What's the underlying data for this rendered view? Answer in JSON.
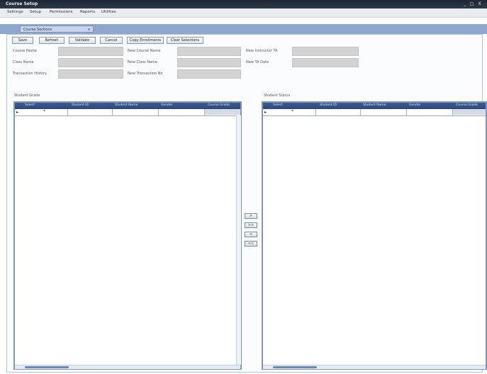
{
  "window": {
    "app_title": "Course Setup",
    "controls": [
      "_",
      "□",
      "X"
    ]
  },
  "menu": [
    "Settings",
    "Setup",
    "Permissions",
    "Reports",
    "Utilities"
  ],
  "document_tab": {
    "label": "Course Sections",
    "close_label": "x"
  },
  "toolbar": [
    "Save",
    "Refresh",
    "Validate",
    "Cancel",
    "Copy Enrollments",
    "Clear Selections"
  ],
  "form": {
    "course_name": {
      "label": "Course Name",
      "value": ""
    },
    "class_name": {
      "label": "Class Name",
      "value": ""
    },
    "transaction_history": {
      "label": "Transaction History",
      "value": ""
    },
    "new_course_name": {
      "label": "New Course Name",
      "value": ""
    },
    "new_class_name": {
      "label": "New Class Name",
      "value": ""
    },
    "new_transaction_no": {
      "label": "New Transaction No",
      "value": ""
    },
    "new_instructor_ta": {
      "label": "New Instructor TA",
      "value": ""
    },
    "new_ta_date": {
      "label": "New TA Date",
      "value": ""
    }
  },
  "left_grid": {
    "title": "Student Grade",
    "columns": [
      "Select",
      "Student ID",
      "Student Name",
      "Gender",
      "Course Grade"
    ],
    "new_row_marker": "*"
  },
  "right_grid": {
    "title": "Student Status",
    "columns": [
      "Select",
      "Student ID",
      "Student Name",
      "Gender",
      "Course Grade"
    ],
    "new_row_marker": "*"
  },
  "transfer_buttons": [
    ">",
    ">>",
    "<",
    "<<"
  ],
  "colors": {
    "title_bar": "#1c2630",
    "tab_strip": "#8fa6cf",
    "grid_header": "#2d4779",
    "panel_border": "#7f96c2",
    "field_fill": "#d3d3d3"
  }
}
